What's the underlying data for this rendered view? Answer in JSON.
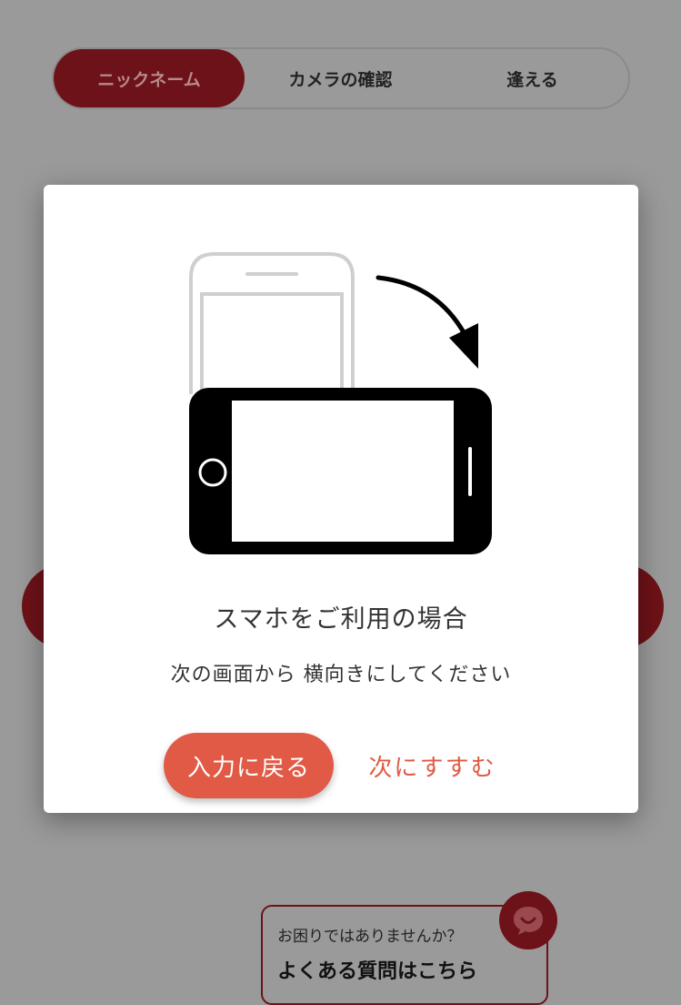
{
  "stepper": {
    "steps": [
      {
        "label": "ニックネーム",
        "active": true
      },
      {
        "label": "カメラの確認",
        "active": false
      },
      {
        "label": "逢える",
        "active": false
      }
    ]
  },
  "modal": {
    "title": "スマホをご利用の場合",
    "subtitle": "次の画面から 横向きにしてください",
    "back_button": "入力に戻る",
    "next_button": "次にすすむ",
    "illustration_icon": "rotate-phone-to-landscape"
  },
  "help": {
    "question": "お困りではありませんか？",
    "link": "よくある質問はこちら",
    "chat_icon": "chat-bubble-smile-icon"
  },
  "colors": {
    "brand": "#6d1218",
    "accent": "#e05a45",
    "overlay_bg": "#9a9a9a"
  }
}
